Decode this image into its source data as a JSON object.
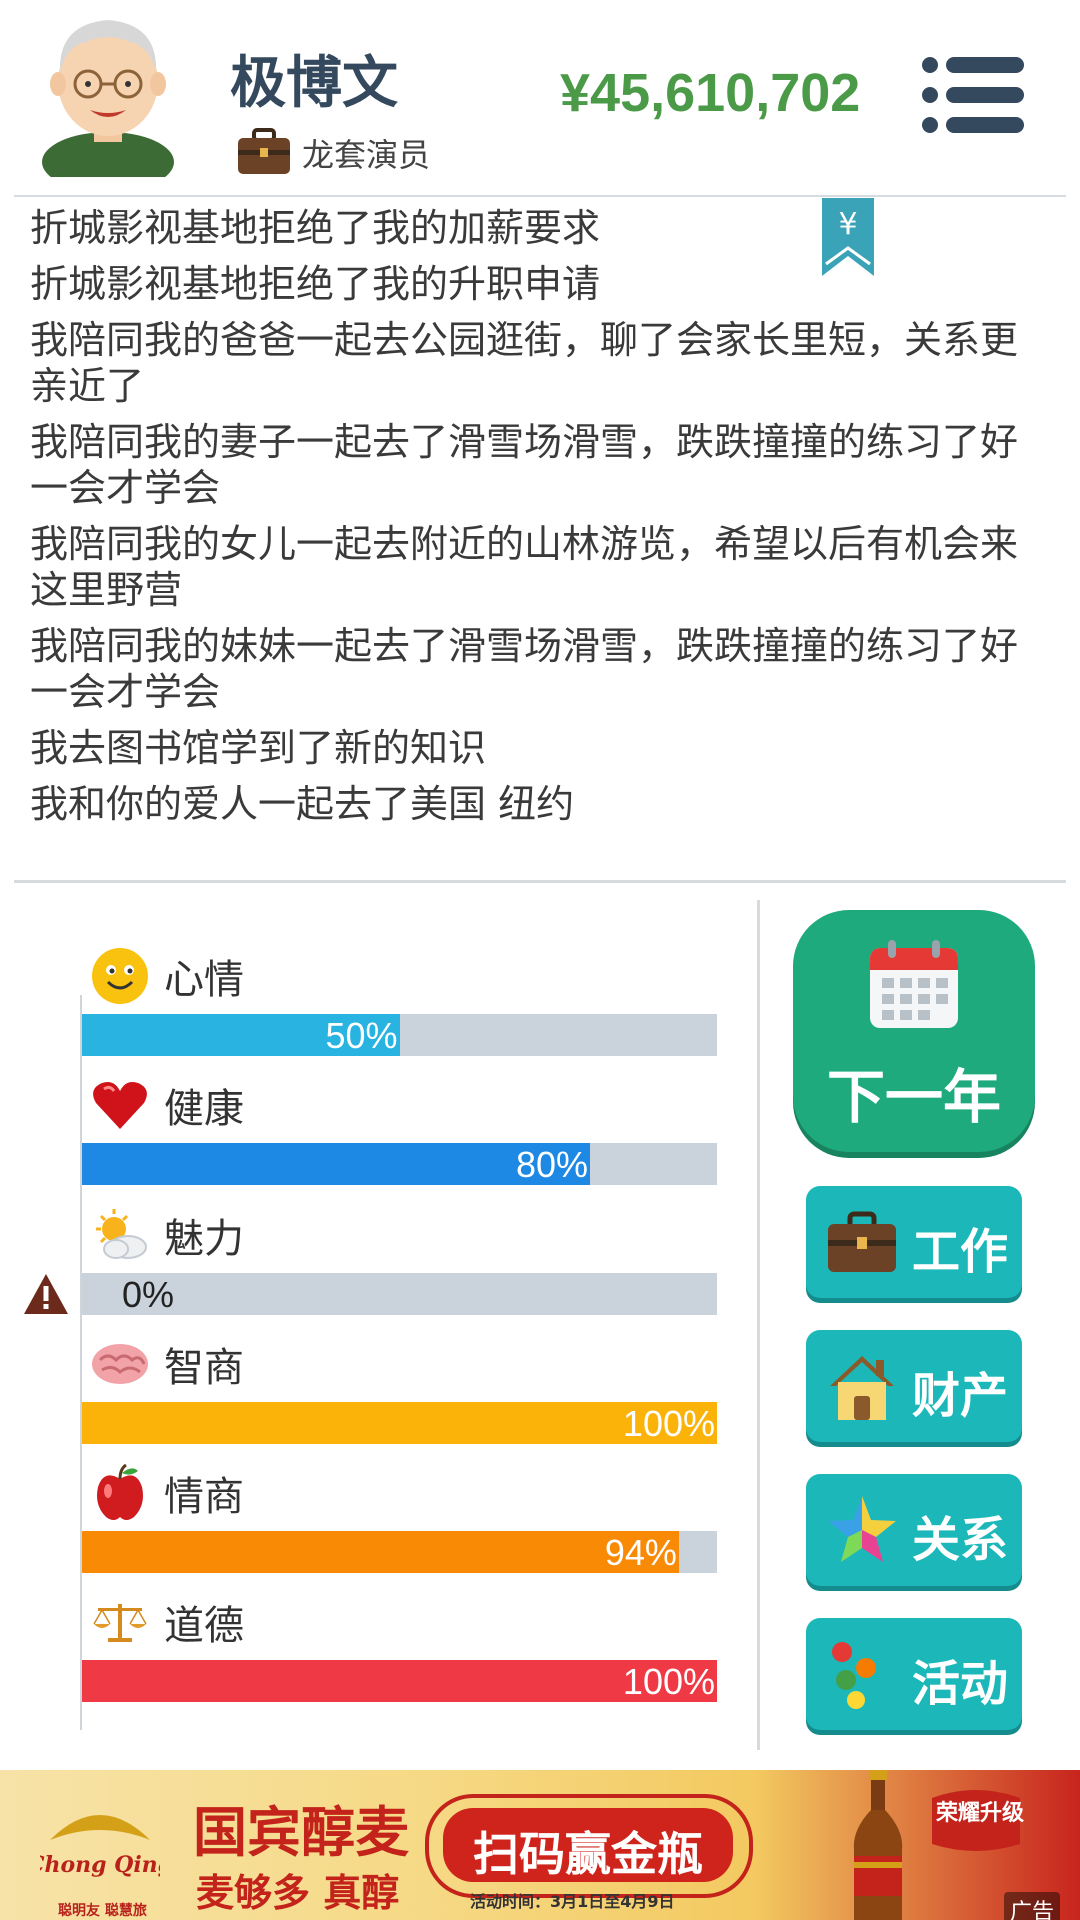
{
  "header": {
    "name": "极博文",
    "job": "龙套演员",
    "money": "¥45,610,702"
  },
  "log": [
    "折城影视基地拒绝了我的加薪要求",
    "折城影视基地拒绝了我的升职申请",
    "我陪同我的爸爸一起去公园逛街，聊了会家长里短，关系更亲近了",
    "我陪同我的妻子一起去了滑雪场滑雪，跌跌撞撞的练习了好一会才学会",
    "我陪同我的女儿一起去附近的山林游览，希望以后有机会来这里野营",
    "我陪同我的妹妹一起去了滑雪场滑雪，跌跌撞撞的练习了好一会才学会",
    "我去图书馆学到了新的知识",
    "我和你的爱人一起去了美国 纽约"
  ],
  "bookmark_symbol": "¥",
  "stats": [
    {
      "label": "心情",
      "value": 50,
      "text": "50%",
      "color": "#29b3e0",
      "icon": "smiley-icon"
    },
    {
      "label": "健康",
      "value": 80,
      "text": "80%",
      "color": "#1e88e5",
      "icon": "heart-icon"
    },
    {
      "label": "魅力",
      "value": 0,
      "text": "0%",
      "color": "#9aa5b0",
      "icon": "sun-cloud-icon"
    },
    {
      "label": "智商",
      "value": 100,
      "text": "100%",
      "color": "#fbb30a",
      "icon": "brain-icon"
    },
    {
      "label": "情商",
      "value": 94,
      "text": "94%",
      "color": "#f98a06",
      "icon": "apple-icon"
    },
    {
      "label": "道德",
      "value": 100,
      "text": "100%",
      "color": "#ef3a46",
      "icon": "scales-icon"
    }
  ],
  "buttons": {
    "next_year": "下一年",
    "work": "工作",
    "property": "财产",
    "relations": "关系",
    "activities": "活动"
  },
  "ad": {
    "logo_text": "Chong Qing",
    "brand_line": "聪明友 聪慧旅",
    "title": "国宾醇麦",
    "subtitle": "麦够多 真醇",
    "cta": "扫码赢金瓶",
    "date": "活动时间：3月1日至4月9日",
    "badge": "荣耀升级",
    "tag": "广告"
  },
  "colors": {
    "money": "#4a9a48",
    "next_button": "#1eaa7c",
    "side_button": "#1cb8b9",
    "bar_track": "#cad3dc"
  }
}
